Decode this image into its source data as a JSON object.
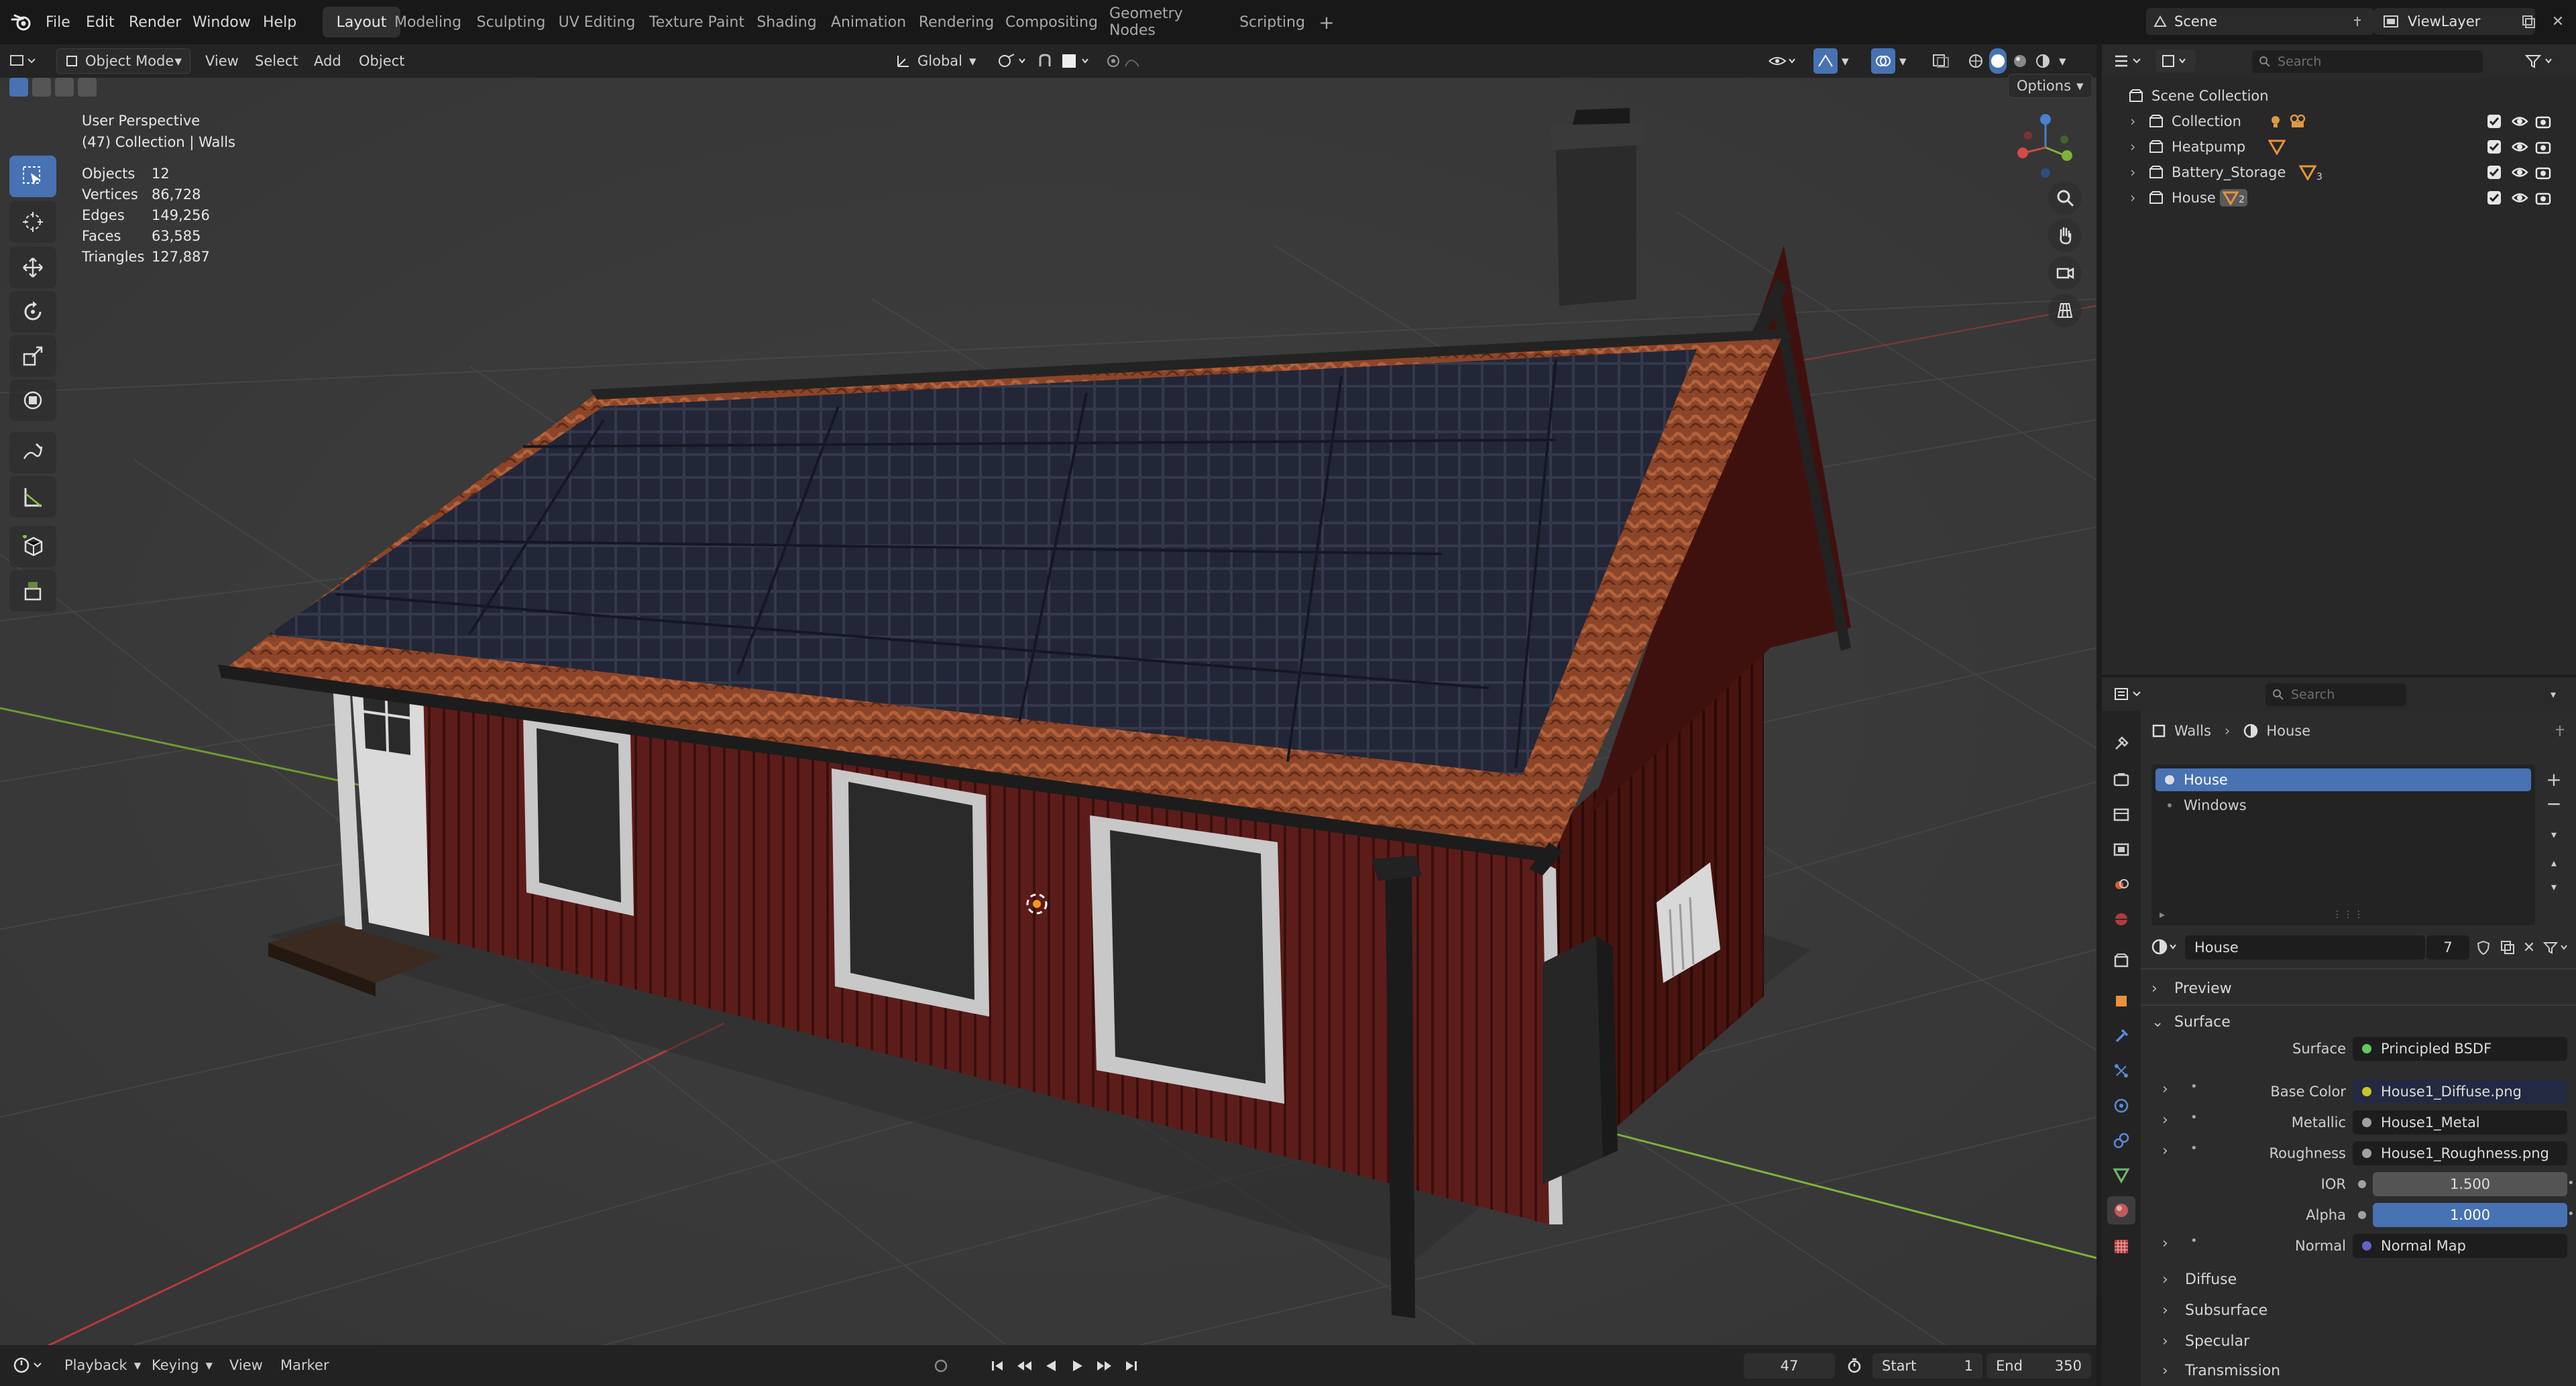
{
  "app": {
    "logo": "blender-logo-icon"
  },
  "menu": [
    "File",
    "Edit",
    "Render",
    "Window",
    "Help"
  ],
  "workspaces": [
    "Layout",
    "Modeling",
    "Sculpting",
    "UV Editing",
    "Texture Paint",
    "Shading",
    "Animation",
    "Rendering",
    "Compositing",
    "Geometry Nodes",
    "Scripting"
  ],
  "active_workspace": "Layout",
  "scene": {
    "name": "Scene",
    "viewlayer": "ViewLayer"
  },
  "viewport": {
    "mode": "Object Mode",
    "menus": [
      "View",
      "Select",
      "Add",
      "Object"
    ],
    "orientation": "Global",
    "options": "Options",
    "perspective": "User Perspective",
    "collection_line": "(47) Collection | Walls",
    "stats": [
      {
        "label": "Objects",
        "value": "12"
      },
      {
        "label": "Vertices",
        "value": "86,728"
      },
      {
        "label": "Edges",
        "value": "149,256"
      },
      {
        "label": "Faces",
        "value": "63,585"
      },
      {
        "label": "Triangles",
        "value": "127,887"
      }
    ],
    "gizmo_axes": [
      "X",
      "Y",
      "Z"
    ]
  },
  "timeline": {
    "menus": [
      "Playback",
      "Keying",
      "View",
      "Marker"
    ],
    "current_frame": "47",
    "start_label": "Start",
    "start": "1",
    "end_label": "End",
    "end": "350"
  },
  "outliner": {
    "search_placeholder": "Search",
    "root": "Scene Collection",
    "items": [
      {
        "name": "Collection"
      },
      {
        "name": "Heatpump"
      },
      {
        "name": "Battery_Storage",
        "badge": "3"
      },
      {
        "name": "House",
        "badge": "2"
      }
    ]
  },
  "properties": {
    "search_placeholder": "Search",
    "breadcrumb": [
      "Walls",
      "House"
    ],
    "slots": [
      "House",
      "Windows"
    ],
    "material_name": "House",
    "users": "7",
    "panels": {
      "preview": "Preview",
      "surface": "Surface"
    },
    "surface_rows": [
      {
        "label": "Surface",
        "value": "Principled BSDF",
        "socket": "#63c763"
      },
      {
        "label": "Base Color",
        "value": "House1_Diffuse.png",
        "socket": "#c7c729"
      },
      {
        "label": "Metallic",
        "value": "House1_Metal",
        "socket": "#a1a1a1"
      },
      {
        "label": "Roughness",
        "value": "House1_Roughness.png",
        "socket": "#a1a1a1"
      },
      {
        "label": "IOR",
        "value": "1.500",
        "socket": "#a1a1a1"
      },
      {
        "label": "Alpha",
        "value": "1.000",
        "socket": "#a1a1a1"
      },
      {
        "label": "Normal",
        "value": "Normal Map",
        "socket": "#6363c7"
      }
    ],
    "subpanels": [
      "Diffuse",
      "Subsurface",
      "Specular",
      "Transmission"
    ]
  },
  "colors": {
    "accent": "#4772b3",
    "wall": "#5a1f1c",
    "roof_tile": "#8f4a2c",
    "solar": "#1e2230",
    "x_axis": "#b33b3b",
    "y_axis": "#7fb23a"
  }
}
